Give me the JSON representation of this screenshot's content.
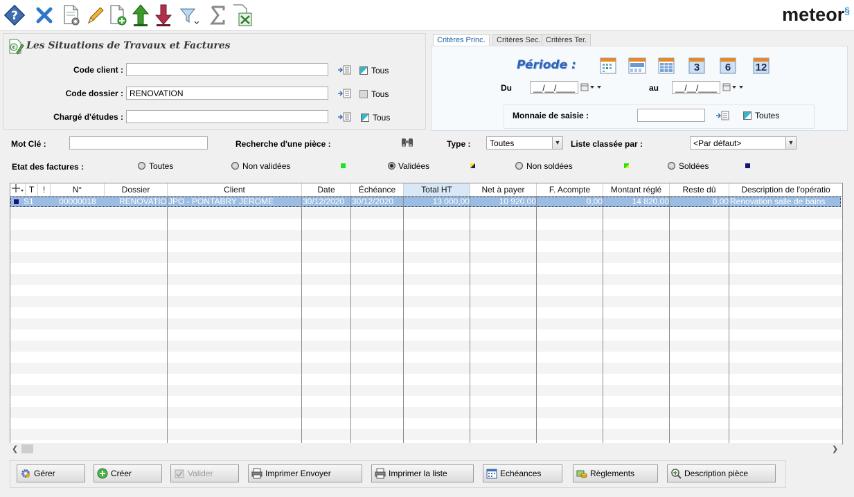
{
  "app": {
    "logo_text": "meteor",
    "brand_color": "#3b90d0"
  },
  "toolbar": {
    "items": [
      "help-icon",
      "close-icon",
      "document-settings-icon",
      "edit-pencil-icon",
      "new-document-icon",
      "arrow-up-icon",
      "arrow-down-icon",
      "filter-icon",
      "sum-icon",
      "excel-export-icon"
    ]
  },
  "criteria": {
    "title": "Les Situations de Travaux et Factures",
    "code_client": {
      "label": "Code client :",
      "value": ""
    },
    "code_dossier": {
      "label": "Code dossier :",
      "value": "RENOVATION"
    },
    "charge_etudes": {
      "label": "Chargé d'études :",
      "value": ""
    },
    "tous_label": "Tous"
  },
  "tabs": [
    "Critères Princ.",
    "Critères Sec.",
    "Critères Ter."
  ],
  "period": {
    "title": "Période :",
    "du_label": "Du",
    "au_label": "au",
    "du_value": "__/__/____",
    "au_value": "__/__/____",
    "btn_3": "3",
    "btn_6": "6",
    "btn_12": "12",
    "monnaie_label": "Monnaie de saisie :",
    "monnaie_value": "",
    "toutes_label": "Toutes"
  },
  "search": {
    "mot_cle_label": "Mot Clé :",
    "mot_cle_value": "",
    "recherche_label": "Recherche d'une pièce :",
    "type_label": "Type :",
    "type_value": "Toutes",
    "liste_label": "Liste classée par :",
    "liste_value": "<Par défaut>"
  },
  "etat": {
    "label": "Etat des factures :",
    "toutes": "Toutes",
    "non_validees": "Non validées",
    "validees": "Validées",
    "non_soldees": "Non soldées",
    "soldees": "Soldées"
  },
  "grid": {
    "headers": [
      "T",
      "!",
      "N°",
      "Dossier",
      "Client",
      "Date",
      "Échéance",
      "Total HT",
      "Net à payer",
      "F. Acompte",
      "Montant réglé",
      "Reste dû",
      "Description de l'opératio"
    ],
    "rows": [
      {
        "t": "S1",
        "n": "00000018",
        "dossier": "RENOVATION",
        "client": "JPO - PONTABRY JEROME",
        "date": "30/12/2020",
        "echeance": "30/12/2020",
        "total_ht": "13 000,00",
        "net": "10 920,00",
        "acompte": "0,00",
        "regle": "14 820,00",
        "reste": "0,00",
        "desc": "Renovation salle de bains"
      }
    ]
  },
  "buttons": {
    "gerer": "Gérer",
    "creer": "Créer",
    "valider": "Valider",
    "imprimer_envoyer": "Imprimer Envoyer",
    "imprimer_liste": "Imprimer la liste",
    "echeances": "Echéances",
    "reglements": "Règlements",
    "description": "Description pièce"
  }
}
